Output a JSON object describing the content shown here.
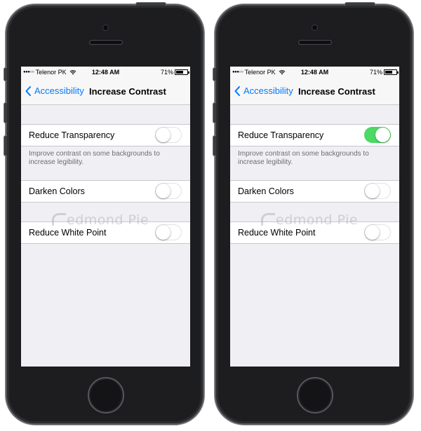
{
  "phones": [
    {
      "status": {
        "carrier": "Telenor PK",
        "time": "12:48 AM",
        "battery": "71%",
        "battery_level": 0.71
      },
      "nav": {
        "back_label": "Accessibility",
        "title": "Increase Contrast"
      },
      "settings": {
        "reduce_transparency": {
          "label": "Reduce Transparency",
          "on": false
        },
        "footer": "Improve contrast on some backgrounds to increase legibility.",
        "darken_colors": {
          "label": "Darken Colors",
          "on": false
        },
        "reduce_white_point": {
          "label": "Reduce White Point",
          "on": false
        }
      },
      "watermark": "edmond Pie"
    },
    {
      "status": {
        "carrier": "Telenor PK",
        "time": "12:48 AM",
        "battery": "71%",
        "battery_level": 0.71
      },
      "nav": {
        "back_label": "Accessibility",
        "title": "Increase Contrast"
      },
      "settings": {
        "reduce_transparency": {
          "label": "Reduce Transparency",
          "on": true
        },
        "footer": "Improve contrast on some backgrounds to increase legibility.",
        "darken_colors": {
          "label": "Darken Colors",
          "on": false
        },
        "reduce_white_point": {
          "label": "Reduce White Point",
          "on": false
        }
      },
      "watermark": "edmond Pie"
    }
  ],
  "colors": {
    "ios_blue": "#007aff",
    "toggle_on": "#4cd964",
    "group_bg": "#efeff4",
    "footer_text": "#6d6d72"
  },
  "icons": {
    "back": "chevron-left-icon",
    "wifi": "wifi-icon",
    "battery": "battery-icon",
    "signal": "signal-dots-icon"
  }
}
